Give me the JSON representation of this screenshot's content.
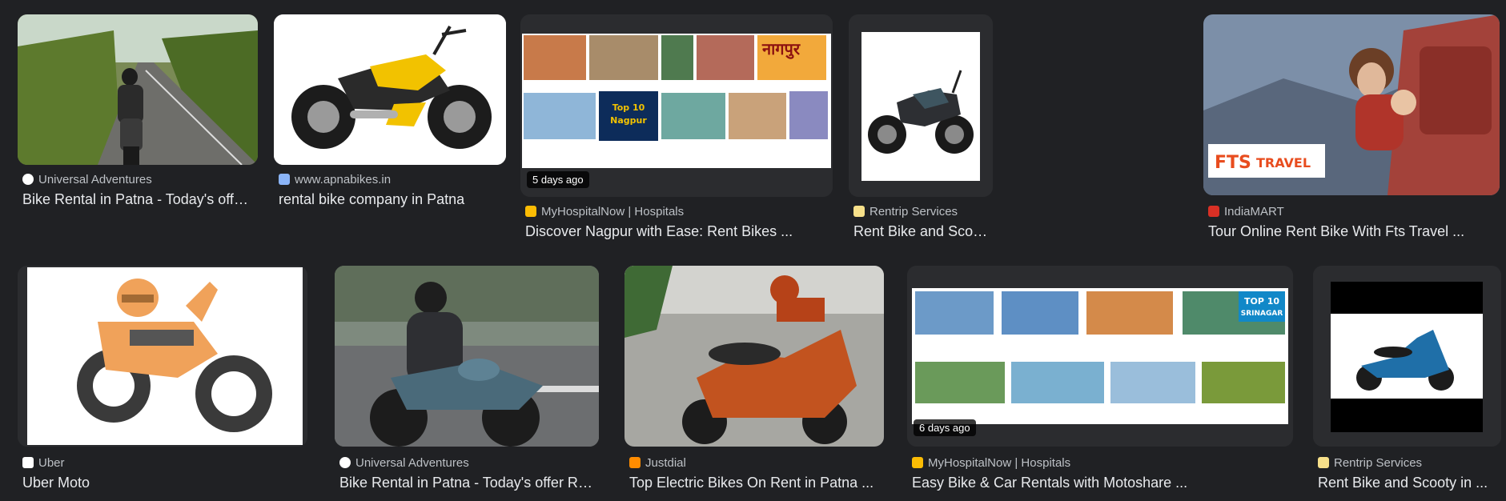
{
  "results": [
    {
      "source": "Universal Adventures",
      "title": "Bike Rental in Patna - Today's offer Rs ...",
      "favicon": "universal-adventures-favicon",
      "favicon_color": "#ffffff",
      "badge": ""
    },
    {
      "source": "www.apnabikes.in",
      "title": "rental bike company in Patna",
      "favicon": "apnabikes-favicon",
      "favicon_color": "#8ab4f8",
      "badge": ""
    },
    {
      "source": "MyHospitalNow | Hospitals",
      "title": "Discover Nagpur with Ease: Rent Bikes ...",
      "favicon": "myhospitalnow-favicon",
      "favicon_color": "#fbbc04",
      "badge": "5 days ago"
    },
    {
      "source": "Rentrip Services",
      "title": "Rent Bike and Scooty i...",
      "favicon": "rentrip-favicon",
      "favicon_color": "#f7e08a",
      "badge": ""
    },
    {
      "source": "IndiaMART",
      "title": "Tour Online Rent Bike With Fts Travel ...",
      "favicon": "indiamart-favicon",
      "favicon_color": "#d93025",
      "badge": ""
    },
    {
      "source": "Uber",
      "title": "Uber Moto",
      "favicon": "uber-favicon",
      "favicon_color": "#ffffff",
      "badge": ""
    },
    {
      "source": "Universal Adventures",
      "title": "Bike Rental in Patna - Today's offer Rs...",
      "favicon": "universal-adventures-favicon",
      "favicon_color": "#ffffff",
      "badge": ""
    },
    {
      "source": "Justdial",
      "title": "Top Electric Bikes On Rent in Patna ...",
      "favicon": "justdial-favicon",
      "favicon_color": "#ff8c00",
      "badge": ""
    },
    {
      "source": "MyHospitalNow | Hospitals",
      "title": "Easy Bike & Car Rentals with Motoshare ...",
      "favicon": "myhospitalnow-favicon",
      "favicon_color": "#fbbc04",
      "badge": "6 days ago"
    },
    {
      "source": "Rentrip Services",
      "title": "Rent Bike and Scooty in ...",
      "favicon": "rentrip-favicon",
      "favicon_color": "#f7e08a",
      "badge": ""
    }
  ],
  "collage_texts": {
    "nagpur_hindi": "नागपुर",
    "top10_nagpur_line1": "Top 10",
    "top10_nagpur_line2": "Nagpur",
    "top10_srinagar_line1": "TOP 10",
    "top10_srinagar_line2": "SRINAGAR",
    "fts_logo": "FTS",
    "fts_word": "TRAVEL"
  }
}
